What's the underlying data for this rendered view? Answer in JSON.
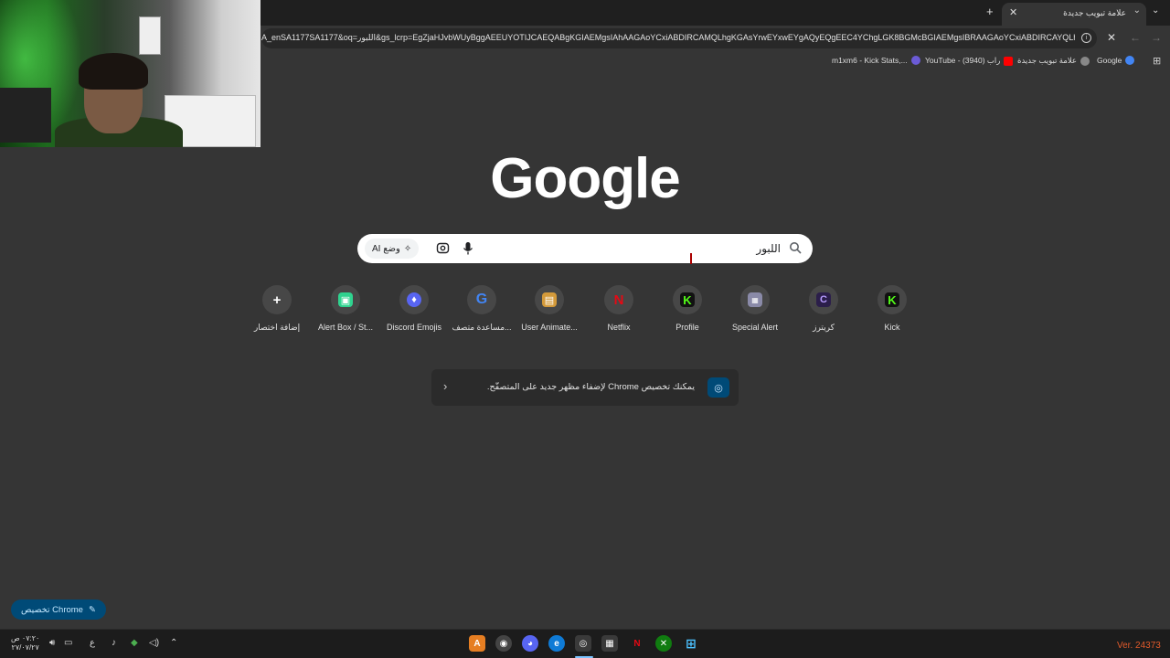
{
  "tab": {
    "title": "علامة تبويب جديدة"
  },
  "toolbar": {
    "url": "A_enSA1177SA1177&oq=اللبور&gs_lcrp=EgZjaHJvbWUyBggAEEUYOTIJCAEQABgKGIAEMgsIAhAAGAoYCxiABDIRCAMQLhgKGAsYrwEYxwEYgAQyEQgEEC4YChgLGK8BGMcBGIAEMgsIBRAAGAoYCxiABDIRCAYQLhgKGAs..."
  },
  "bookmarks": [
    {
      "label": "Google",
      "color": "#4285f4"
    },
    {
      "label": "علامة تبويب جديدة",
      "color": "#888888"
    },
    {
      "label": "YouTube - (3940) راب",
      "color": "#ff0000"
    },
    {
      "label": "m1xm6 - Kick Stats,...",
      "color": "#6b5bd6"
    }
  ],
  "logo": {
    "text": "Google"
  },
  "search": {
    "query": "اللبور",
    "ai_mode_label": "وضع AI"
  },
  "shortcuts": [
    {
      "label": "إضافة اختصار",
      "icon": "+",
      "color": "#474747"
    },
    {
      "label": "Alert Box / St...",
      "icon": "A",
      "color": "#2fd38f"
    },
    {
      "label": "Discord Emojis",
      "icon": "D",
      "color": "#5865f2"
    },
    {
      "label": "مساعدة متصف...",
      "icon": "G",
      "color": "#4285f4"
    },
    {
      "label": "User Animate...",
      "icon": "U",
      "color": "#d49a3a"
    },
    {
      "label": "Netflix",
      "icon": "N",
      "color": "#e50914"
    },
    {
      "label": "Profile",
      "icon": "K",
      "color": "#53fc18"
    },
    {
      "label": "Special Alert",
      "icon": "S",
      "color": "#8a8aa8"
    },
    {
      "label": "كريترز",
      "icon": "C",
      "color": "#2b1e4a"
    },
    {
      "label": "Kick",
      "icon": "K",
      "color": "#53fc18"
    }
  ],
  "banner": {
    "text": "يمكنك تخصيص Chrome لإضفاء مظهر جديد على المتصفّح."
  },
  "customize_button": {
    "label": "تخصيص Chrome"
  },
  "taskbar": {
    "time": "٠٧:٢٠ ص",
    "date": "٢٧/٠٧/٢٧",
    "lang": "ع",
    "version": "Ver. 24373"
  },
  "colors": {
    "background": "#353535",
    "tabstrip": "#1f1f1f",
    "accent": "#004a77",
    "version_text": "#e15a2b"
  }
}
